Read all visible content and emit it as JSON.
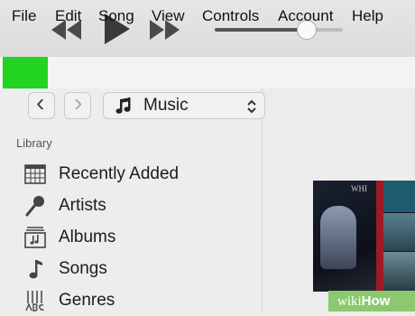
{
  "menubar": {
    "items": [
      {
        "label": "File"
      },
      {
        "label": "Edit"
      },
      {
        "label": "Song"
      },
      {
        "label": "View"
      },
      {
        "label": "Controls"
      },
      {
        "label": "Account"
      },
      {
        "label": "Help"
      }
    ]
  },
  "player": {
    "volume_level": 0.72
  },
  "nav": {
    "back_glyph": "‹",
    "forward_glyph": "›"
  },
  "source": {
    "label": "Music",
    "icon": "music-note-icon"
  },
  "library": {
    "heading": "Library",
    "items": [
      {
        "label": "Recently Added",
        "icon": "recently-added-icon"
      },
      {
        "label": "Artists",
        "icon": "microphone-icon"
      },
      {
        "label": "Albums",
        "icon": "album-icon"
      },
      {
        "label": "Songs",
        "icon": "music-note-icon"
      },
      {
        "label": "Genres",
        "icon": "genres-icon"
      }
    ]
  },
  "album_art": {
    "partial_text": "WHI"
  },
  "watermark": {
    "prefix": "wiki",
    "suffix": "How"
  },
  "colors": {
    "highlight": "#22d322",
    "watermark": "#8cc86e"
  }
}
